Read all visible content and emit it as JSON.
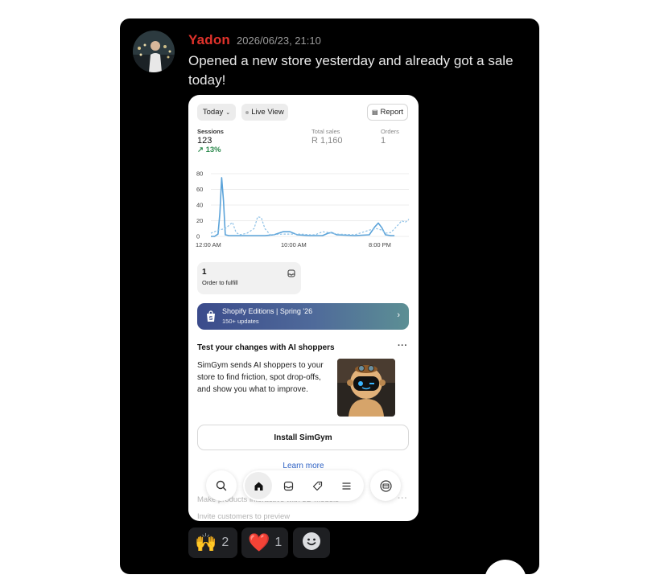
{
  "message": {
    "username": "Yadon",
    "timestamp": "2026/06/23, 21:10",
    "text": "Opened a new store yesterday and already got a sale today!"
  },
  "screenshot": {
    "filters": {
      "range": "Today",
      "live_view": "Live View",
      "report": "Report"
    },
    "metrics": {
      "sessions_label": "Sessions",
      "sessions_value": "123",
      "sessions_change": "13%",
      "sales_label": "Total sales",
      "sales_value": "R 1,160",
      "orders_label": "Orders",
      "orders_value": "1"
    },
    "chart_data": {
      "type": "line",
      "x_tick_labels": [
        "12:00 AM",
        "10:00 AM",
        "8:00 PM"
      ],
      "y_tick_labels": [
        "80",
        "60",
        "40",
        "20",
        "0"
      ],
      "ylim": [
        0,
        80
      ],
      "grid": true,
      "series": [
        {
          "style": "solid",
          "color": "#5ba3d9",
          "points": [
            [
              0,
              0
            ],
            [
              2,
              0
            ],
            [
              4,
              3
            ],
            [
              5,
              30
            ],
            [
              6,
              75
            ],
            [
              7,
              45
            ],
            [
              8,
              2
            ],
            [
              10,
              1
            ],
            [
              20,
              1
            ],
            [
              30,
              1
            ],
            [
              35,
              2
            ],
            [
              40,
              6
            ],
            [
              44,
              6
            ],
            [
              48,
              2
            ],
            [
              55,
              1
            ],
            [
              62,
              1
            ],
            [
              65,
              4
            ],
            [
              67,
              5
            ],
            [
              70,
              2
            ],
            [
              80,
              1
            ],
            [
              88,
              2
            ],
            [
              91,
              12
            ],
            [
              93,
              17
            ],
            [
              95,
              11
            ],
            [
              97,
              2
            ],
            [
              100,
              1
            ],
            [
              102,
              1
            ]
          ]
        },
        {
          "style": "dashed",
          "color": "#8cc0e6",
          "points": [
            [
              0,
              4
            ],
            [
              4,
              8
            ],
            [
              8,
              10
            ],
            [
              12,
              18
            ],
            [
              14,
              5
            ],
            [
              16,
              2
            ],
            [
              20,
              4
            ],
            [
              24,
              10
            ],
            [
              26,
              25
            ],
            [
              28,
              24
            ],
            [
              30,
              10
            ],
            [
              33,
              2
            ],
            [
              40,
              3
            ],
            [
              50,
              3
            ],
            [
              55,
              2
            ],
            [
              58,
              2
            ],
            [
              62,
              6
            ],
            [
              65,
              5
            ],
            [
              70,
              3
            ],
            [
              80,
              2
            ],
            [
              88,
              8
            ],
            [
              92,
              10
            ],
            [
              95,
              8
            ],
            [
              97,
              4
            ],
            [
              100,
              5
            ],
            [
              103,
              12
            ],
            [
              106,
              20
            ],
            [
              108,
              18
            ],
            [
              110,
              22
            ]
          ]
        }
      ]
    },
    "fulfill": {
      "count": "1",
      "label": "Order to fulfill"
    },
    "banner": {
      "title": "Shopify Editions | Spring '26",
      "subtitle": "150+ updates"
    },
    "ai": {
      "title": "Test your changes with AI shoppers",
      "body": "SimGym sends AI shoppers to your store to find friction, spot drop-offs, and show you what to improve.",
      "button": "Install SimGym",
      "link": "Learn more"
    },
    "faded": {
      "line1": "Make products interactive with 3D models",
      "line2": "Invite customers to preview"
    }
  },
  "reactions": [
    {
      "emoji": "🙌",
      "count": "2"
    },
    {
      "emoji": "❤️",
      "count": "1"
    }
  ],
  "colors": {
    "username": "#e0322b",
    "accent_link": "#2f62c4",
    "trend_up": "#2d8a4e"
  }
}
